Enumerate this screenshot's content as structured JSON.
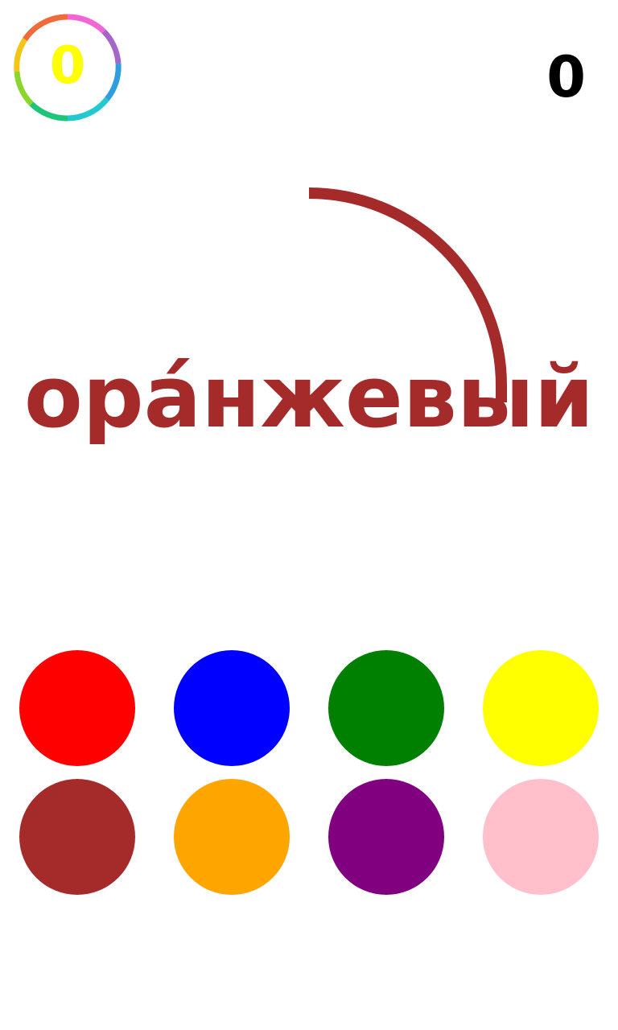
{
  "hud": {
    "badge_value": "0",
    "score": "0"
  },
  "prompt": {
    "word": "ора́нжевый",
    "text_color": "#a52a2a",
    "timer_color": "#a52a2a"
  },
  "colors": {
    "badge_text": "#ffff00",
    "swatches": [
      "#ff0000",
      "#0000ff",
      "#008000",
      "#ffff00",
      "#a52a2a",
      "#ffa500",
      "#800080",
      "#ffc0cb"
    ]
  },
  "swatch_names": [
    "red",
    "blue",
    "green",
    "yellow",
    "brown",
    "orange",
    "purple",
    "pink"
  ]
}
